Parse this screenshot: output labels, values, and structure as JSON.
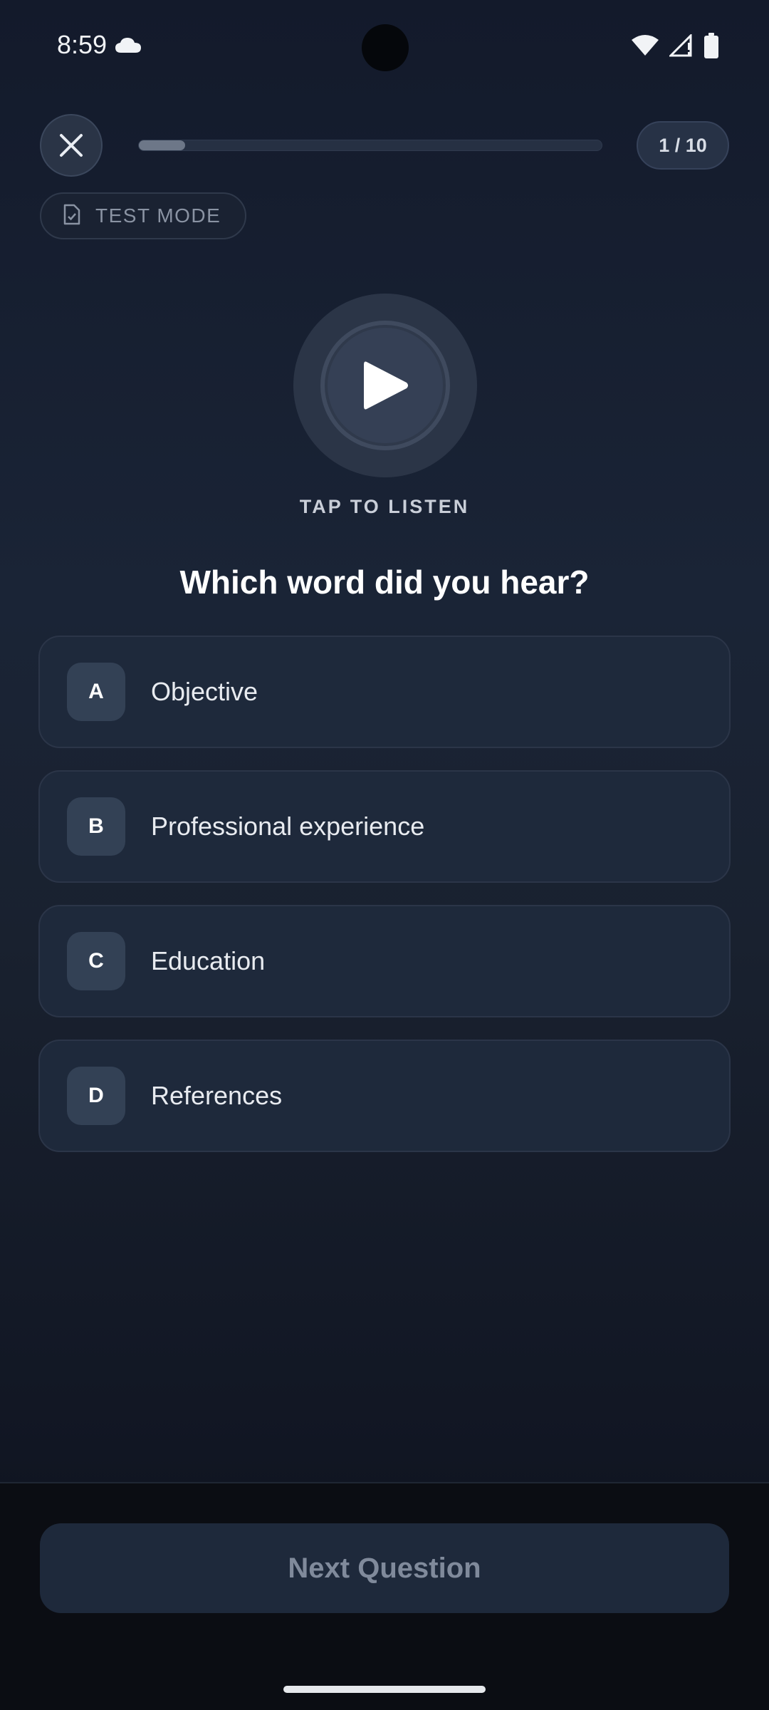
{
  "status_bar": {
    "time": "8:59",
    "icons": [
      "cloud-icon",
      "wifi-icon",
      "signal-icon",
      "battery-icon"
    ]
  },
  "header": {
    "close_icon": "close-icon",
    "progress": {
      "current": 1,
      "total": 10,
      "fraction": 0.1
    },
    "counter": "1 / 10",
    "mode_badge": {
      "icon": "document-check-icon",
      "label": "TEST MODE"
    }
  },
  "audio": {
    "play_icon": "play-icon",
    "label": "TAP TO LISTEN"
  },
  "question": "Which word did you hear?",
  "options": [
    {
      "letter": "A",
      "text": "Objective"
    },
    {
      "letter": "B",
      "text": "Professional experience"
    },
    {
      "letter": "C",
      "text": "Education"
    },
    {
      "letter": "D",
      "text": "References"
    }
  ],
  "footer": {
    "next_label": "Next Question"
  },
  "colors": {
    "background_top": "#131a2b",
    "card": "#1e293b",
    "letter_badge": "#334155",
    "next_text": "#808a9b"
  }
}
